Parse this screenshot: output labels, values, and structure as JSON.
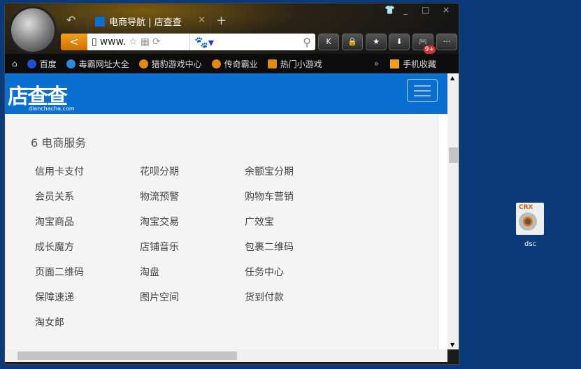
{
  "browser": {
    "tab_title": "电商导航 | 店查查",
    "tab_close": "×",
    "new_tab": "+",
    "url": "www.",
    "back": "<",
    "window_controls": [
      "_",
      "□",
      "×"
    ],
    "toolbar_buttons": [
      "K",
      "🔒",
      "★",
      "⬇",
      "🎮",
      "···"
    ],
    "badge": "9+",
    "bookmarks": [
      "百度",
      "毒霸网址大全",
      "猎豹游戏中心",
      "传奇霸业",
      "热门小游戏"
    ],
    "more": "»",
    "mobile_fav": "手机收藏"
  },
  "site": {
    "brand": "店查查",
    "domain": "dianchacha.com",
    "section_title": "6 电商服务",
    "items": [
      "信用卡支付",
      "花呗分期",
      "余额宝分期",
      "会员关系",
      "物流预警",
      "购物车营销",
      "淘宝商品",
      "淘宝交易",
      "广效宝",
      "成长魔方",
      "店铺音乐",
      "包裹二维码",
      "页面二维码",
      "淘盘",
      "任务中心",
      "保障速递",
      "图片空间",
      "货到付款",
      "淘女郎"
    ]
  },
  "desktop": {
    "file_type": "CRX",
    "label": "dsc"
  }
}
